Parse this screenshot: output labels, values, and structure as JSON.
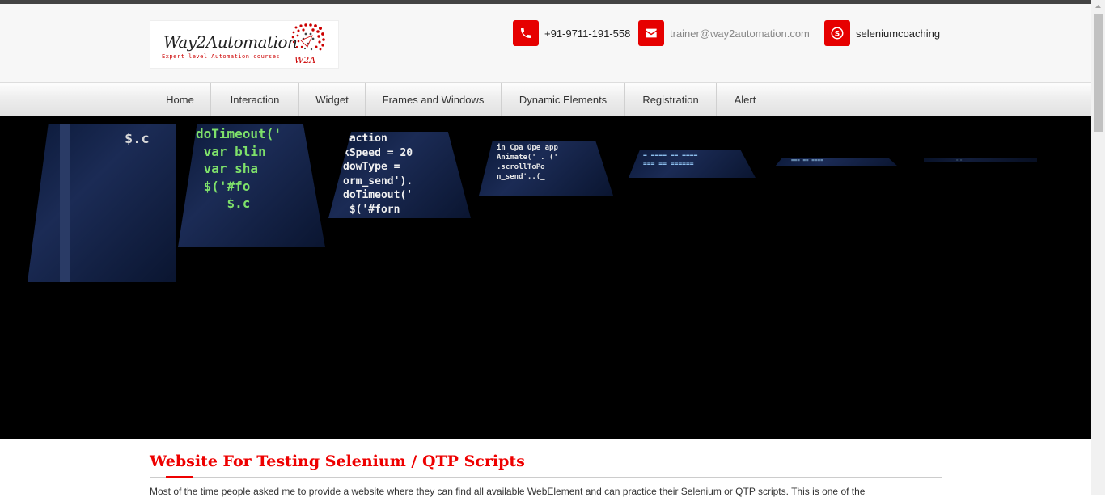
{
  "header": {
    "logo": {
      "title": "Way2Automation",
      "tagline": "Expert level Automation courses",
      "mark": "W2A"
    },
    "contacts": [
      {
        "icon": "phone-icon",
        "text": "+91-9711-191-558"
      },
      {
        "icon": "envelope-icon",
        "text": "trainer@way2automation.com"
      },
      {
        "icon": "skype-icon",
        "text": "seleniumcoaching"
      }
    ]
  },
  "nav": {
    "items": [
      {
        "label": "Home"
      },
      {
        "label": "Interaction"
      },
      {
        "label": "Widget"
      },
      {
        "label": "Frames and Windows"
      },
      {
        "label": "Dynamic Elements"
      },
      {
        "label": "Registration"
      },
      {
        "label": "Alert"
      }
    ]
  },
  "banner": {
    "tiles": [
      {
        "code": "$.c"
      },
      {
        "code": "doTimeout('\n var blin\n var sha\n $('#fo\n    $.c"
      },
      {
        "code": "'action\nkSpeed = 20\ndowType =\norm_send').\ndoTimeout('\n $('#forn"
      },
      {
        "code": "in Cpa Ope app\nAnimate(' . ('\n.scrollToPo\nn_send'..(_"
      },
      {
        "code": "= ==== == ====\n=== == ======"
      },
      {
        "code": "=== == ===="
      },
      {
        "code": "= ="
      }
    ]
  },
  "content": {
    "heading": "Website For Testing Selenium / QTP Scripts",
    "paragraph": "Most of the time people asked me to provide a website where they can find all available WebElement and can practice their Selenium or QTP scripts. This is one of the"
  },
  "colors": {
    "accent": "#e60000",
    "header_bg": "#f7f7f7",
    "banner_bg": "#000000"
  }
}
